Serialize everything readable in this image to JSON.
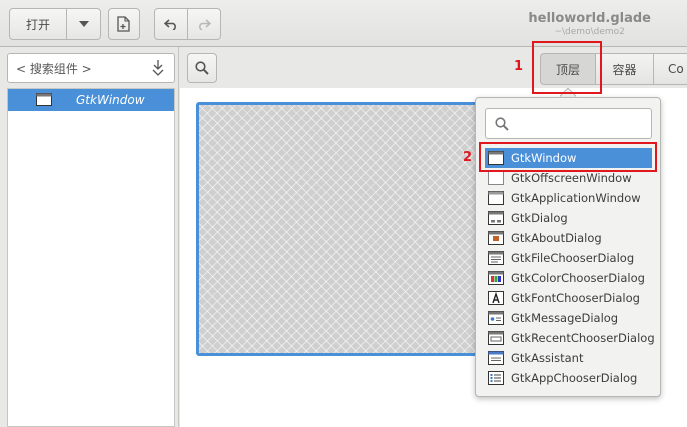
{
  "header": {
    "open_label": "打开",
    "title": "helloworld.glade",
    "subtitle": "~\\demo\\demo2"
  },
  "sidebar": {
    "search_label": "< 搜索组件 >",
    "tree": [
      {
        "label": "GtkWindow"
      }
    ]
  },
  "tabs": {
    "toplevel": "顶层",
    "containers": "容器",
    "control": "Co"
  },
  "annotations": {
    "marker1": "1",
    "marker2": "2"
  },
  "popover": {
    "items": [
      {
        "label": "GtkWindow",
        "icon": "window-icon"
      },
      {
        "label": "GtkOffscreenWindow",
        "icon": "offscreen-window-icon"
      },
      {
        "label": "GtkApplicationWindow",
        "icon": "application-window-icon"
      },
      {
        "label": "GtkDialog",
        "icon": "dialog-icon"
      },
      {
        "label": "GtkAboutDialog",
        "icon": "about-dialog-icon"
      },
      {
        "label": "GtkFileChooserDialog",
        "icon": "file-chooser-dialog-icon"
      },
      {
        "label": "GtkColorChooserDialog",
        "icon": "color-chooser-dialog-icon"
      },
      {
        "label": "GtkFontChooserDialog",
        "icon": "font-chooser-dialog-icon"
      },
      {
        "label": "GtkMessageDialog",
        "icon": "message-dialog-icon"
      },
      {
        "label": "GtkRecentChooserDialog",
        "icon": "recent-chooser-dialog-icon"
      },
      {
        "label": "GtkAssistant",
        "icon": "assistant-icon"
      },
      {
        "label": "GtkAppChooserDialog",
        "icon": "app-chooser-dialog-icon"
      }
    ]
  },
  "colors": {
    "selection": "#4a90d9",
    "annotation": "#e0181e"
  }
}
